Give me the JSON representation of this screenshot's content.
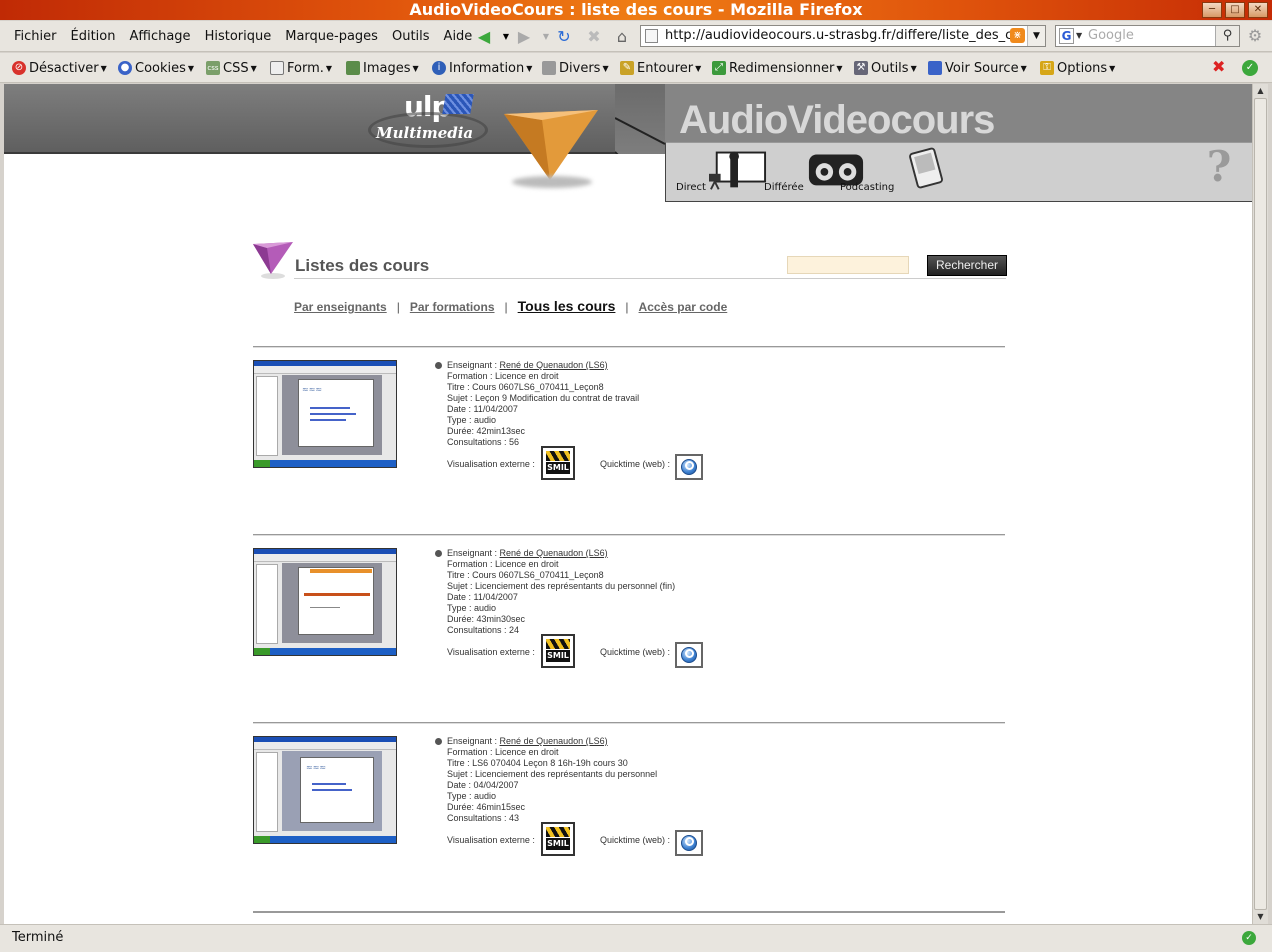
{
  "window": {
    "title": "AudioVideoCours : liste des cours - Mozilla Firefox"
  },
  "menubar": {
    "items": [
      "Fichier",
      "Édition",
      "Affichage",
      "Historique",
      "Marque-pages",
      "Outils",
      "Aide"
    ]
  },
  "navbar": {
    "url": "http://audiovideocours.u-strasbg.fr/differe/liste_des_c",
    "search_placeholder": "Google"
  },
  "devbar": {
    "items": [
      "Désactiver",
      "Cookies",
      "CSS",
      "Form.",
      "Images",
      "Information",
      "Divers",
      "Entourer",
      "Redimensionner",
      "Outils",
      "Voir Source",
      "Options"
    ]
  },
  "site": {
    "logo_text": "ulp",
    "logo_sub": "Multimedia",
    "title": "AudioVideocours",
    "modes": [
      "Direct",
      "Différée",
      "Podcasting"
    ],
    "help": "?"
  },
  "page": {
    "title": "Listes des cours",
    "search_button": "Rechercher",
    "tabs": [
      "Par enseignants",
      "Par formations",
      "Tous les cours",
      "Accès par code"
    ],
    "active_tab_index": 2
  },
  "labels": {
    "enseignant": "Enseignant : ",
    "formation": "Formation : ",
    "titre": "Titre : ",
    "sujet": "Sujet : ",
    "date": "Date : ",
    "type": "Type : ",
    "duree": "Durée: ",
    "consultations": "Consultations : ",
    "visualisation": "Visualisation externe :",
    "quicktime": "Quicktime (web) :",
    "smil": "SMIL"
  },
  "courses": [
    {
      "enseignant": "René de Quenaudon (LS6)",
      "formation": "Licence en droit",
      "titre": "Cours 0607LS6_070411_Leçon8",
      "sujet": "Leçon 9 Modification du contrat de travail",
      "date": "11/04/2007",
      "type": "audio",
      "duree": "42min13sec",
      "consultations": "56"
    },
    {
      "enseignant": "René de Quenaudon (LS6)",
      "formation": "Licence en droit",
      "titre": "Cours 0607LS6_070411_Leçon8",
      "sujet": "Licenciement des représentants du personnel (fin)",
      "date": "11/04/2007",
      "type": "audio",
      "duree": "43min30sec",
      "consultations": "24"
    },
    {
      "enseignant": "René de Quenaudon (LS6)",
      "formation": "Licence en droit",
      "titre": "LS6 070404 Leçon 8 16h-19h cours 30",
      "sujet": "Licenciement des représentants du personnel",
      "date": "04/04/2007",
      "type": "audio",
      "duree": "46min15sec",
      "consultations": "43"
    }
  ],
  "status": {
    "text": "Terminé"
  }
}
